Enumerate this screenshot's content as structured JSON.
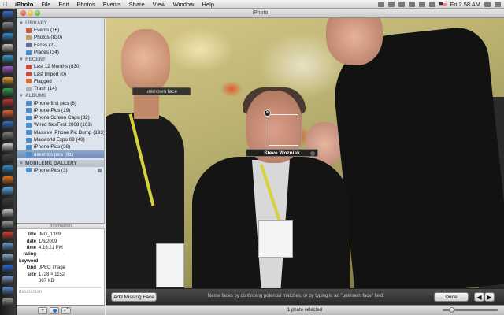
{
  "menubar": {
    "apple": "",
    "items": [
      "iPhoto",
      "File",
      "Edit",
      "Photos",
      "Events",
      "Share",
      "View",
      "Window",
      "Help"
    ],
    "clock": "Fri 2 58 AM"
  },
  "window": {
    "title": "iPhoto"
  },
  "sidebar": {
    "library_header": "LIBRARY",
    "library": [
      {
        "label": "Events (16)",
        "color": "#d25a3a"
      },
      {
        "label": "Photos (830)",
        "color": "#c79a5a"
      },
      {
        "label": "Faces (2)",
        "color": "#6b6b9a"
      },
      {
        "label": "Places (34)",
        "color": "#4a8fd0"
      }
    ],
    "recent_header": "RECENT",
    "recent": [
      {
        "label": "Last 12 Months (830)",
        "color": "#d24a3a"
      },
      {
        "label": "Last Import (0)",
        "color": "#d24a3a"
      },
      {
        "label": "Flagged",
        "color": "#e06a2a"
      },
      {
        "label": "Trash (14)",
        "color": "#b0b0b0"
      }
    ],
    "albums_header": "ALBUMS",
    "albums": [
      {
        "label": "iPhone first pics (8)",
        "color": "#4a8fd0"
      },
      {
        "label": "iPhone Pics (19)",
        "color": "#4a8fd0"
      },
      {
        "label": "iPhone Screen Caps (32)",
        "color": "#4a8fd0"
      },
      {
        "label": "Wired NexFest 2008 (103)",
        "color": "#4a8fd0"
      },
      {
        "label": "Massive iPhone Pic Dump (193)",
        "color": "#4a8fd0"
      },
      {
        "label": "Macworld Expo 09 (46)",
        "color": "#4a8fd0"
      },
      {
        "label": "iPhone Pics (38)",
        "color": "#4a8fd0"
      },
      {
        "label": "axxeltics pics (81)",
        "color": "#4a8fd0",
        "selected": true
      }
    ],
    "mobileme_header": "MOBILEME GALLERY",
    "mobileme": [
      {
        "label": "iPhone Pics (3)",
        "color": "#4a8fd0"
      }
    ]
  },
  "info": {
    "header": "Information",
    "title_label": "title",
    "title_value": "IMG_1389",
    "date_label": "date",
    "date_value": "1/6/2009",
    "time_label": "time",
    "time_value": "4:16:21 PM",
    "rating_label": "rating",
    "rating_value": "· · · · ·",
    "keyword_label": "keyword",
    "kind_label": "kind",
    "kind_value": "JPEG Image",
    "size_label": "size",
    "size_value": "1728 × 1152",
    "filesize_value": "887 KB",
    "description_placeholder": "description"
  },
  "photo": {
    "unknown_face_label": "unknown face",
    "named_face_label": "Steve Wozniak"
  },
  "faces_bar": {
    "add_missing_label": "Add Missing Face",
    "hint": "Name faces by confirming potential matches, or by typing in an \"unknown face\" field.",
    "done_label": "Done"
  },
  "status": {
    "selection": "1 photo selected"
  },
  "dock_colors": [
    "#3a6ad0",
    "#8a8a8a",
    "#2a8ad0",
    "#c0c0c0",
    "#3a9ad0",
    "#a05ad0",
    "#e0a030",
    "#30a050",
    "#c03030",
    "#e06030",
    "#3070c0",
    "#7a7a7a",
    "#d0d0d0",
    "#404040",
    "#2a8ad0",
    "#e07020",
    "#5aa0e0",
    "#3a3a3a",
    "#c0c0c0",
    "#a0a0a0",
    "#d04030",
    "#6a9ad0",
    "#8ab0d0",
    "#2a6ad0",
    "#7aa0d0",
    "#5a8ad0",
    "#9a9a9a"
  ]
}
